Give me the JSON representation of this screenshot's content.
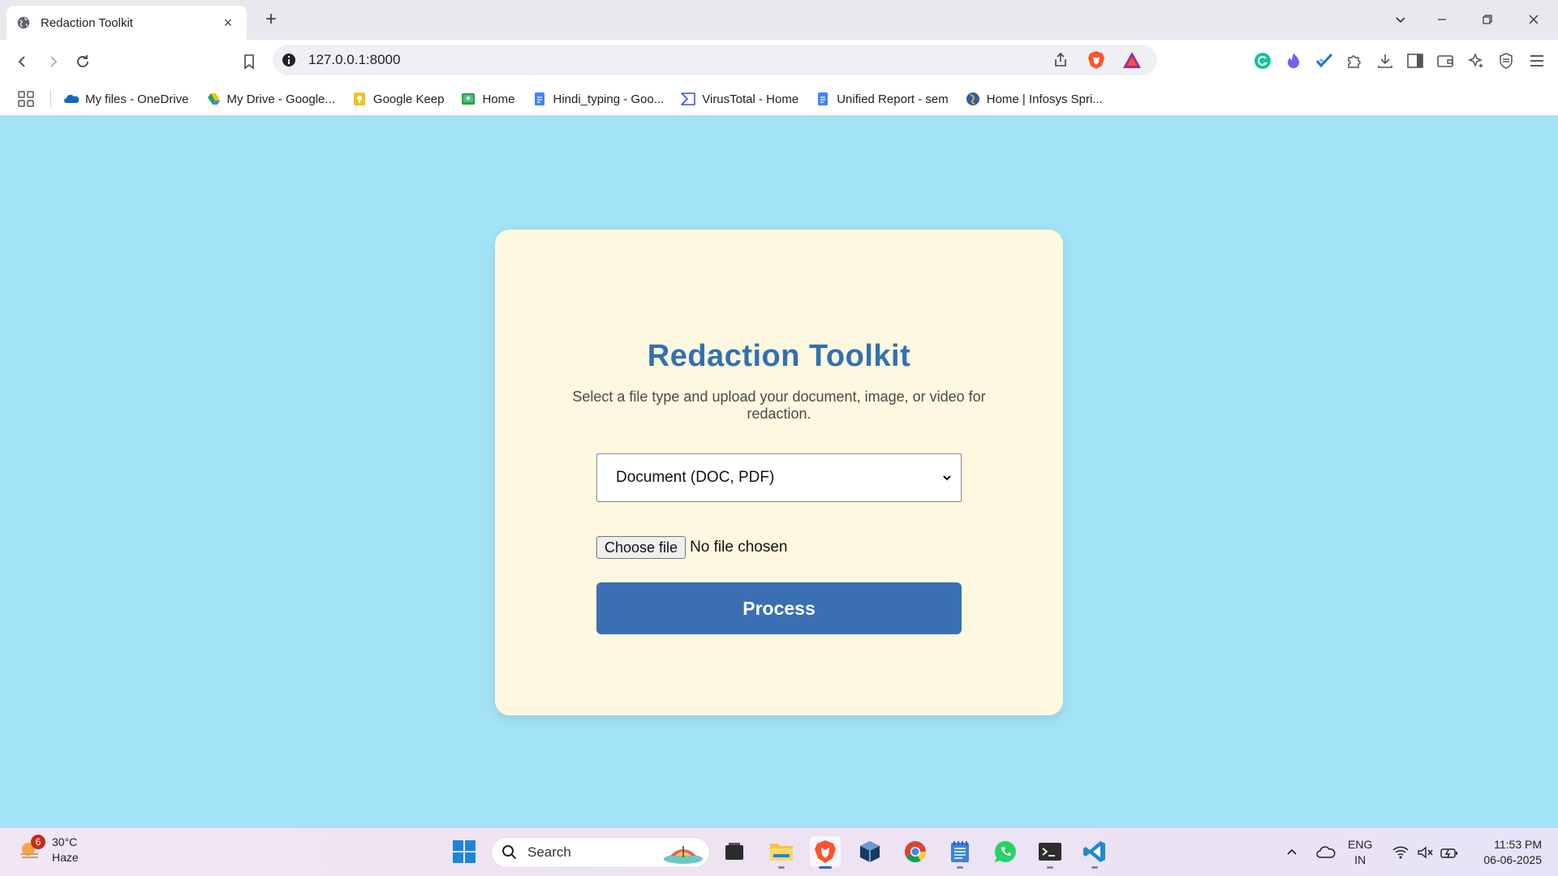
{
  "browser": {
    "tab_title": "Redaction Toolkit",
    "url": "127.0.0.1:8000",
    "bookmarks": [
      {
        "label": "My files - OneDrive",
        "icon": "onedrive-icon",
        "color": "#0f6cbd"
      },
      {
        "label": "My Drive - Google...",
        "icon": "google-drive-icon",
        "color": "#1fa463"
      },
      {
        "label": "Google Keep",
        "icon": "google-keep-icon",
        "color": "#f6bf26"
      },
      {
        "label": "Home",
        "icon": "classroom-icon",
        "color": "#25a244"
      },
      {
        "label": "Hindi_typing - Goo...",
        "icon": "google-docs-icon",
        "color": "#4285f4"
      },
      {
        "label": "VirusTotal - Home",
        "icon": "virustotal-icon",
        "color": "#394eff"
      },
      {
        "label": "Unified Report - sem",
        "icon": "google-docs-icon",
        "color": "#4285f4"
      },
      {
        "label": "Home | Infosys Spri...",
        "icon": "infosys-icon",
        "color": "#2b5ea8"
      }
    ]
  },
  "page": {
    "title": "Redaction Toolkit",
    "subtitle": "Select a file type and upload your document, image, or video for redaction.",
    "file_type_selected": "Document (DOC, PDF)",
    "choose_file_label": "Choose file",
    "no_file_text": "No file chosen",
    "process_label": "Process"
  },
  "colors": {
    "page_background": "#a3e3f8",
    "card_background": "#fdf8df",
    "title_color": "#3270b0",
    "button_color": "#3a70b3"
  },
  "taskbar": {
    "weather_temp": "30°C",
    "weather_desc": "Haze",
    "weather_badge": "6",
    "search_placeholder": "Search",
    "lang_line1": "ENG",
    "lang_line2": "IN",
    "time": "11:53 PM",
    "date": "06-06-2025"
  }
}
